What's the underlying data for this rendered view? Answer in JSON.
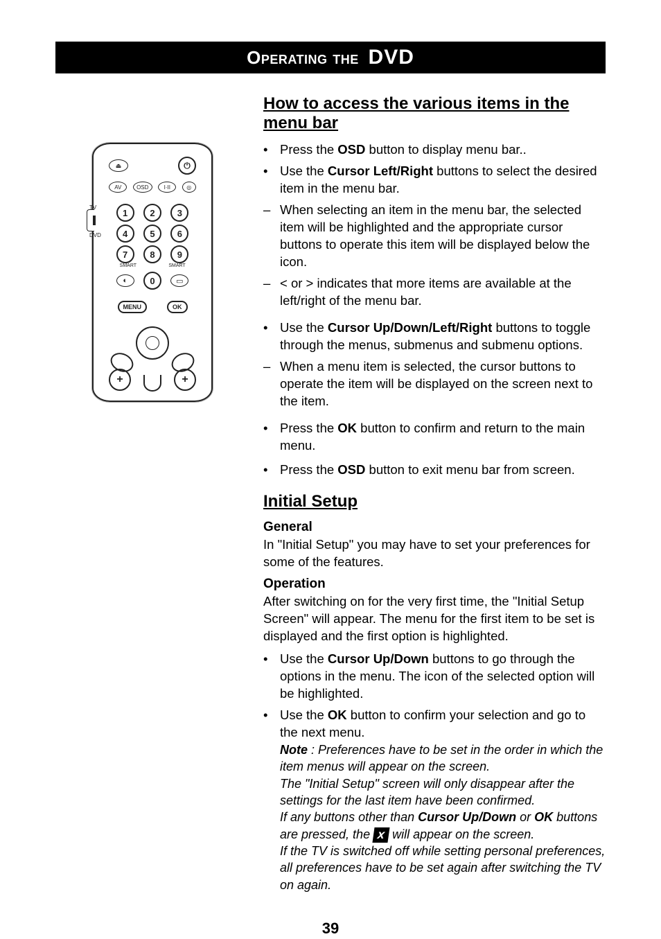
{
  "title_bar": {
    "left": "Operating  the",
    "right": "DVD"
  },
  "section1": {
    "heading": "How to access the various items in the menu bar",
    "items": [
      {
        "marker": "•",
        "pre": "Press the ",
        "bold": "OSD",
        "post": " button to display menu bar.."
      },
      {
        "marker": "•",
        "pre": "Use the ",
        "bold": "Cursor Left/Right",
        "post": " buttons to select the desired item in the menu bar."
      },
      {
        "marker": "–",
        "pre": "When selecting an item in the menu bar, the selected item will be highlighted and the appropriate cursor buttons to operate this item will be displayed below the icon.",
        "bold": "",
        "post": ""
      },
      {
        "marker": "–",
        "pre": "",
        "angleLeft": "<",
        "mid": " or ",
        "angleRight": ">",
        "post": "  indicates that more items are available at the left/right of the menu bar."
      },
      {
        "marker": "•",
        "pre": "Use the ",
        "bold": "Cursor Up/Down/Left/Right",
        "post": " buttons to toggle through the menus, submenus and submenu options."
      },
      {
        "marker": "–",
        "pre": "When a menu item is selected, the cursor buttons to operate the item will be displayed on the screen next to the item.",
        "bold": "",
        "post": ""
      },
      {
        "marker": "•",
        "pre": "Press the ",
        "bold": "OK",
        "post": " button to confirm and return to the main menu."
      },
      {
        "marker": "•",
        "pre": "Press the ",
        "bold": "OSD",
        "post": " button to exit menu bar from screen."
      }
    ]
  },
  "section2": {
    "heading": "Initial Setup",
    "general_label": "General",
    "general_text": "In \"Initial Setup\" you may have to set your preferences for some of the features.",
    "operation_label": "Operation",
    "operation_text": "After switching on for the very first time, the \"Initial Setup Screen\" will appear.  The menu for the first item to be set is displayed and the first option is highlighted.",
    "items": [
      {
        "marker": "•",
        "pre": "Use the ",
        "bold": "Cursor Up/Down",
        "post": " buttons to go through the options in the menu. The icon of the selected option will be highlighted."
      },
      {
        "marker": "•",
        "pre": "Use the ",
        "bold": "OK",
        "post": " button to confirm your selection and go to the next menu."
      }
    ],
    "note": {
      "prefix": "Note",
      "line1": " : Preferences have to be set in the order in which the item menus will appear on the screen.",
      "line2": "The \"Initial Setup\" screen will only disappear after the settings for the last item have been confirmed.",
      "line3a": "If any buttons other than ",
      "bold3": "Cursor Up/Down",
      "line3b": " or ",
      "bold3c": "OK",
      "line3d": " buttons are pressed, the ",
      "xchar": "x",
      "line3e": "  will appear on the screen.",
      "line4": "If the TV is switched off while setting personal preferences, all preferences have to be set again after switching the TV on again."
    }
  },
  "remote": {
    "eject": "⏏",
    "power": "⏻",
    "av": "AV",
    "osd": "OSD",
    "stereo": "I·II",
    "disc": "◎",
    "n1": "1",
    "n2": "2",
    "n3": "3",
    "n4": "4",
    "n5": "5",
    "n6": "6",
    "n7": "7",
    "n8": "8",
    "n9": "9",
    "n0": "0",
    "smart": "SMART",
    "pic": "◐",
    "wide": "▭",
    "menu": "MENU",
    "ok": "OK",
    "tv": "TV",
    "dvd": "DVD",
    "plus": "+"
  },
  "page_number": "39"
}
